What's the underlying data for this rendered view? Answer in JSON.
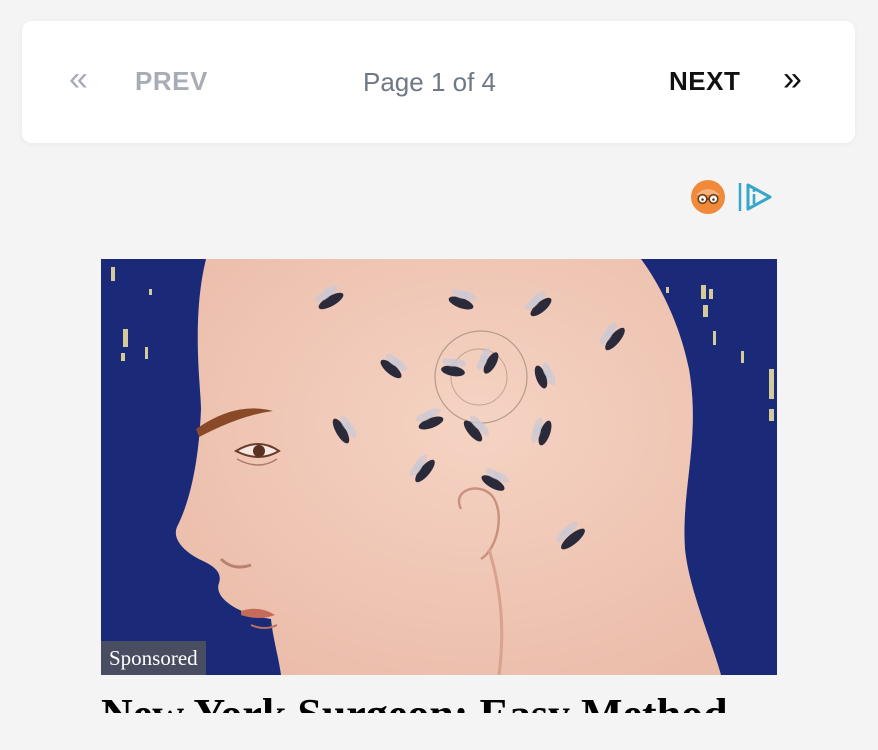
{
  "pagination": {
    "prev_icon": "«",
    "prev_label": "PREV",
    "page_indicator": "Page 1 of 4",
    "next_label": "NEXT",
    "next_icon": "»"
  },
  "ad": {
    "brand_icon": "outbrain-glasses-icon",
    "choices_icon": "adchoices-icon",
    "image_subject": "bald-man-with-bees-illustration",
    "sponsored_label": "Sponsored",
    "headline": "New York Surgeon: Easy Method"
  },
  "colors": {
    "page_background": "#f4f4f4",
    "pager_background": "#ffffff",
    "prev_text": "#a8adb5",
    "indicator_text": "#6e7886",
    "next_text": "#111111",
    "brand_orange": "#f08a3a",
    "adchoices_blue": "#38a6c8",
    "image_sky": "#1b2a78",
    "image_skin": "#f0c8b5"
  }
}
